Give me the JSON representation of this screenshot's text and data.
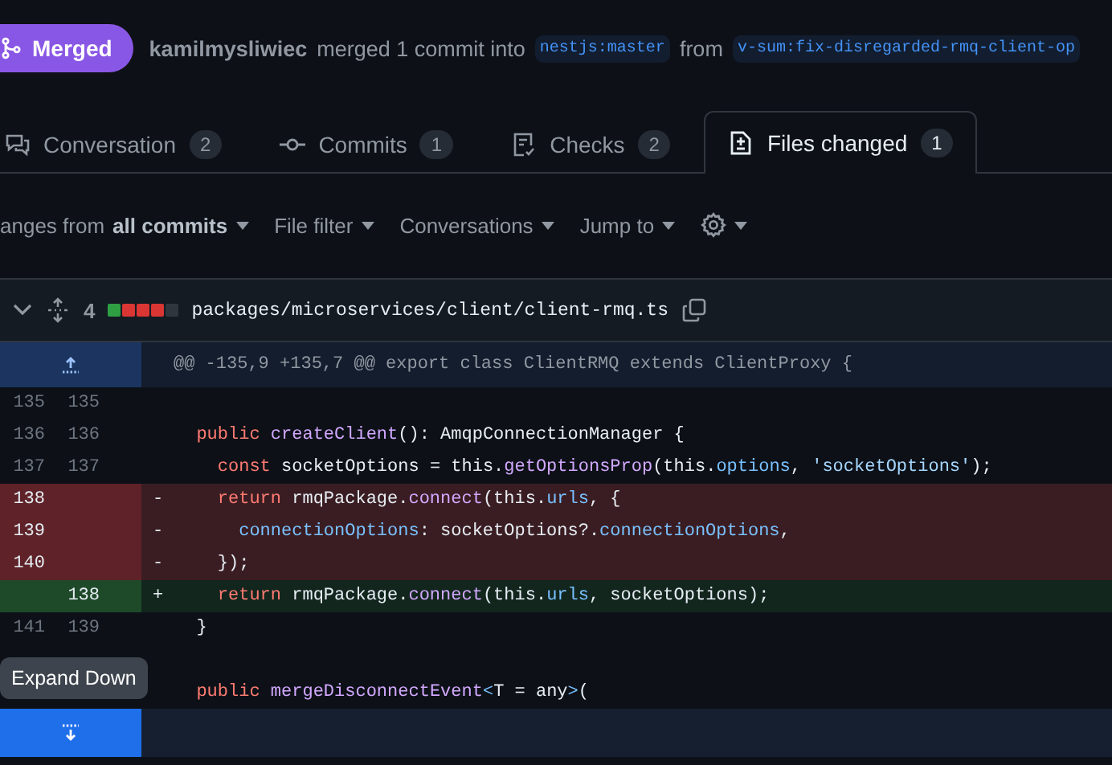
{
  "pr_header": {
    "status": "Merged",
    "author": "kamilmysliwiec",
    "action": "merged 1 commit into",
    "base_branch": "nestjs:master",
    "from_word": "from",
    "head_branch": "v-sum:fix-disregarded-rmq-client-op"
  },
  "tabs": [
    {
      "label": "Conversation",
      "count": "2",
      "kind": "conversation",
      "selected": false
    },
    {
      "label": "Commits",
      "count": "1",
      "kind": "commit",
      "selected": false
    },
    {
      "label": "Checks",
      "count": "2",
      "kind": "checks",
      "selected": false
    },
    {
      "label": "Files changed",
      "count": "1",
      "kind": "files",
      "selected": true
    }
  ],
  "toolbar": {
    "items": [
      {
        "label": "anges from **all commits**",
        "kind": "text"
      },
      {
        "label": "File filter",
        "kind": "text"
      },
      {
        "label": "Conversations",
        "kind": "text"
      },
      {
        "label": "Jump to",
        "kind": "text"
      },
      {
        "kind": "gear"
      }
    ]
  },
  "file": {
    "changes": "4",
    "diffstat": [
      {
        "kind": "added"
      },
      {
        "kind": "deleted"
      },
      {
        "kind": "deleted"
      },
      {
        "kind": "deleted"
      },
      {
        "kind": "neutral"
      }
    ],
    "path": "packages/microservices/client/client-rmq.ts",
    "hunk": "@@ -135,9 +135,7 @@ export class ClientRMQ extends ClientProxy {",
    "lines": [
      {
        "kind": "context",
        "old": "135",
        "new": "135"
      },
      {
        "kind": "context",
        "old": "136",
        "new": "136",
        "tokens": [
          {
            "text": "  public ",
            "kind": "keyword"
          },
          {
            "text": "createClient",
            "kind": "function"
          },
          {
            "text": "(): AmqpConnectionManager {",
            "kind": "plain"
          }
        ]
      },
      {
        "kind": "context",
        "old": "137",
        "new": "137",
        "tokens": [
          {
            "text": "    const",
            "kind": "keyword"
          },
          {
            "text": " socketOptions = this.",
            "kind": "plain"
          },
          {
            "text": "getOptionsProp",
            "kind": "function"
          },
          {
            "text": "(this.",
            "kind": "plain"
          },
          {
            "text": "options",
            "kind": "property"
          },
          {
            "text": ", ",
            "kind": "plain"
          },
          {
            "text": "'socketOptions'",
            "kind": "string"
          },
          {
            "text": ");",
            "kind": "plain"
          }
        ]
      },
      {
        "kind": "deletion",
        "old": "138",
        "sign": "-",
        "tokens": [
          {
            "text": "    return",
            "kind": "keyword"
          },
          {
            "text": " rmqPackage.",
            "kind": "plain"
          },
          {
            "text": "connect",
            "kind": "function"
          },
          {
            "text": "(this.",
            "kind": "plain"
          },
          {
            "text": "urls",
            "kind": "property"
          },
          {
            "text": ", {",
            "kind": "plain"
          }
        ]
      },
      {
        "kind": "deletion",
        "old": "139",
        "sign": "-",
        "tokens": [
          {
            "text": "      connectionOptions",
            "kind": "property"
          },
          {
            "text": ": socketOptions?.",
            "kind": "plain"
          },
          {
            "text": "connectionOptions",
            "kind": "property"
          },
          {
            "text": ",",
            "kind": "plain"
          }
        ]
      },
      {
        "kind": "deletion",
        "old": "140",
        "sign": "-",
        "tokens": [
          {
            "text": "    });",
            "kind": "plain"
          }
        ]
      },
      {
        "kind": "addition",
        "new": "138",
        "sign": "+",
        "tokens": [
          {
            "text": "    return",
            "kind": "keyword"
          },
          {
            "text": " rmqPackage.",
            "kind": "plain"
          },
          {
            "text": "connect",
            "kind": "function"
          },
          {
            "text": "(this.",
            "kind": "plain"
          },
          {
            "text": "urls",
            "kind": "property"
          },
          {
            "text": ", socketOptions);",
            "kind": "plain"
          }
        ]
      },
      {
        "kind": "context",
        "old": "141",
        "new": "139",
        "tokens": [
          {
            "text": "  }",
            "kind": "plain"
          }
        ]
      },
      {
        "kind": "context"
      },
      {
        "kind": "context",
        "tokens": [
          {
            "text": "  public ",
            "kind": "keyword"
          },
          {
            "text": "mergeDisconnectEvent",
            "kind": "function"
          },
          {
            "text": "<",
            "kind": "property"
          },
          {
            "text": "T = any",
            "kind": "plain"
          },
          {
            "text": ">",
            "kind": "property"
          },
          {
            "text": "(",
            "kind": "plain"
          }
        ]
      }
    ],
    "tooltip": "Expand Down"
  }
}
